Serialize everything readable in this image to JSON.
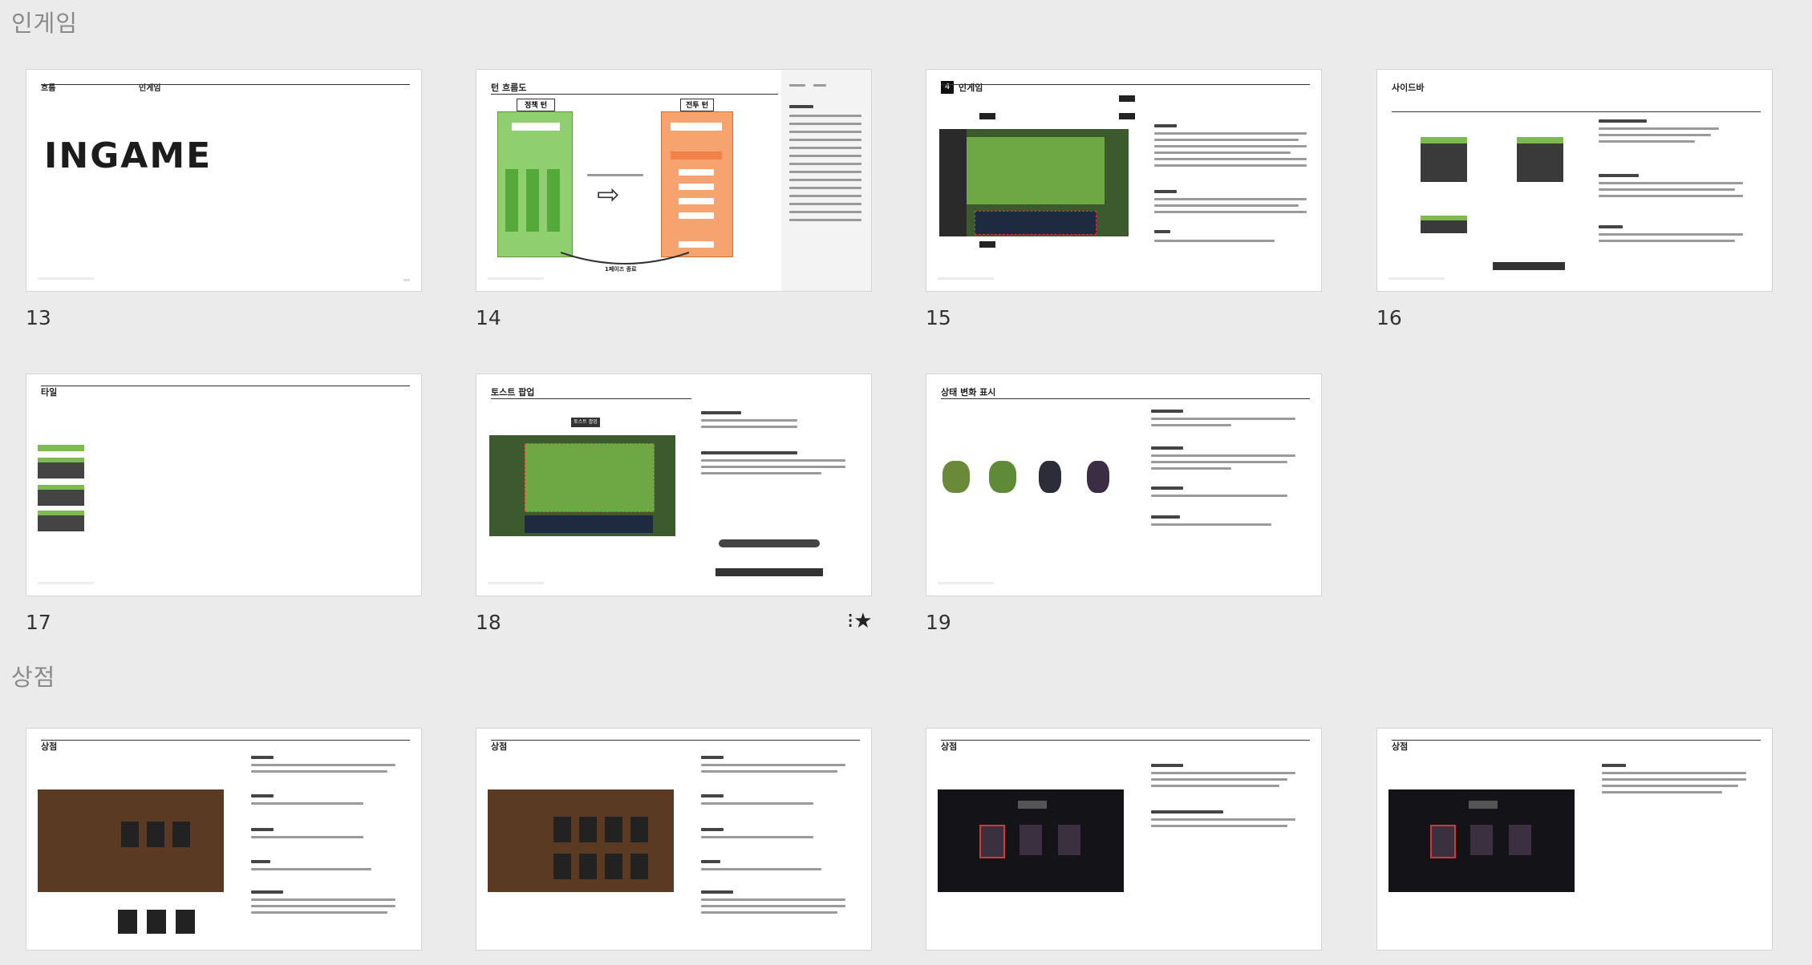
{
  "sections": [
    {
      "header": "인게임"
    },
    {
      "header": "상점"
    }
  ],
  "slides": [
    {
      "number": "13",
      "title": "INGAME",
      "label_left": "흐름",
      "label_mid": "인게임"
    },
    {
      "number": "14",
      "title": "턴 흐름도",
      "box_left": "정책 턴",
      "box_right": "전투 턴",
      "arrow_label": "1페이즈 종료"
    },
    {
      "number": "15",
      "title": "인게임",
      "badge": "4"
    },
    {
      "number": "16",
      "title": "사이드바"
    },
    {
      "number": "17",
      "title": "타일"
    },
    {
      "number": "18",
      "title": "토스트 팝업",
      "toast": "토스트 팝업"
    },
    {
      "number": "19",
      "title": "상태 변화 표시"
    },
    {
      "number": "",
      "title": "상점"
    },
    {
      "number": "",
      "title": "상점"
    },
    {
      "number": "",
      "title": "상점"
    },
    {
      "number": "",
      "title": "상점"
    }
  ],
  "icons": {
    "star": "star-icon"
  }
}
